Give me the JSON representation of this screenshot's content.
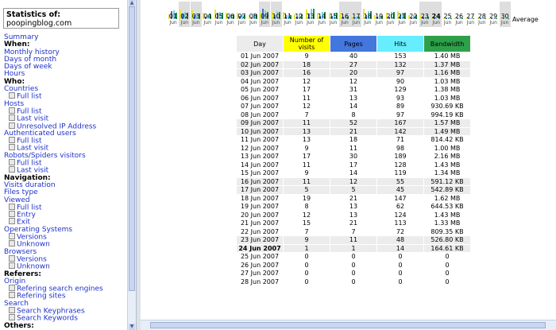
{
  "sidebar": {
    "stat_title": "Statistics of:",
    "stat_site": "poopingblog.com",
    "items": [
      {
        "text": "Summary",
        "kind": "link",
        "indent": 0
      },
      {
        "text": "When:",
        "kind": "hdr",
        "indent": 0
      },
      {
        "text": "Monthly history",
        "kind": "link",
        "indent": 0
      },
      {
        "text": "Days of month",
        "kind": "link",
        "indent": 0
      },
      {
        "text": "Days of week",
        "kind": "link",
        "indent": 0
      },
      {
        "text": "Hours",
        "kind": "link",
        "indent": 0
      },
      {
        "text": "Who:",
        "kind": "hdr",
        "indent": 0
      },
      {
        "text": "Countries",
        "kind": "link",
        "indent": 0
      },
      {
        "text": "Full list",
        "kind": "link",
        "indent": 1
      },
      {
        "text": "Hosts",
        "kind": "link",
        "indent": 0
      },
      {
        "text": "Full list",
        "kind": "link",
        "indent": 1
      },
      {
        "text": "Last visit",
        "kind": "link",
        "indent": 1
      },
      {
        "text": "Unresolved IP Address",
        "kind": "link",
        "indent": 1
      },
      {
        "text": "Authenticated users",
        "kind": "link",
        "indent": 0
      },
      {
        "text": "Full list",
        "kind": "link",
        "indent": 1
      },
      {
        "text": "Last visit",
        "kind": "link",
        "indent": 1
      },
      {
        "text": "Robots/Spiders visitors",
        "kind": "link",
        "indent": 0
      },
      {
        "text": "Full list",
        "kind": "link",
        "indent": 1
      },
      {
        "text": "Last visit",
        "kind": "link",
        "indent": 1
      },
      {
        "text": "Navigation:",
        "kind": "hdr",
        "indent": 0
      },
      {
        "text": "Visits duration",
        "kind": "link",
        "indent": 0
      },
      {
        "text": "Files type",
        "kind": "link",
        "indent": 0
      },
      {
        "text": "Viewed",
        "kind": "link",
        "indent": 0
      },
      {
        "text": "Full list",
        "kind": "link",
        "indent": 1
      },
      {
        "text": "Entry",
        "kind": "link",
        "indent": 1
      },
      {
        "text": "Exit",
        "kind": "link",
        "indent": 1
      },
      {
        "text": "Operating Systems",
        "kind": "link",
        "indent": 0
      },
      {
        "text": "Versions",
        "kind": "link",
        "indent": 1
      },
      {
        "text": "Unknown",
        "kind": "link",
        "indent": 1
      },
      {
        "text": "Browsers",
        "kind": "link",
        "indent": 0
      },
      {
        "text": "Versions",
        "kind": "link",
        "indent": 1
      },
      {
        "text": "Unknown",
        "kind": "link",
        "indent": 1
      },
      {
        "text": "Referers:",
        "kind": "hdr",
        "indent": 0
      },
      {
        "text": "Origin",
        "kind": "link",
        "indent": 0
      },
      {
        "text": "Refering search engines",
        "kind": "link",
        "indent": 1
      },
      {
        "text": "Refering sites",
        "kind": "link",
        "indent": 1
      },
      {
        "text": "Search",
        "kind": "link",
        "indent": 0
      },
      {
        "text": "Search Keyphrases",
        "kind": "link",
        "indent": 1
      },
      {
        "text": "Search Keywords",
        "kind": "link",
        "indent": 1
      },
      {
        "text": "Others:",
        "kind": "hdr",
        "indent": 0
      }
    ]
  },
  "day_strip": {
    "days": [
      "01",
      "02",
      "03",
      "04",
      "05",
      "06",
      "07",
      "08",
      "09",
      "10",
      "11",
      "12",
      "13",
      "14",
      "15",
      "16",
      "17",
      "18",
      "19",
      "20",
      "21",
      "22",
      "23",
      "24",
      "25",
      "26",
      "27",
      "28",
      "29",
      "30"
    ],
    "months": [
      "Jun",
      "Jun",
      "Jun",
      "Jun",
      "Jun",
      "Jun",
      "Jun",
      "Jun",
      "Jun",
      "Jun",
      "Jun",
      "Jun",
      "Jun",
      "Jun",
      "Jun",
      "Jun",
      "Jun",
      "Jun",
      "Jun",
      "Jun",
      "Jun",
      "Jun",
      "Jun",
      "Jun",
      "Jun",
      "Jun",
      "Jun",
      "Jun",
      "Jun",
      "Jun"
    ],
    "weekend": [
      false,
      true,
      true,
      false,
      false,
      false,
      false,
      false,
      true,
      true,
      false,
      false,
      false,
      false,
      false,
      true,
      true,
      false,
      false,
      false,
      false,
      false,
      true,
      true,
      false,
      false,
      false,
      false,
      false,
      true
    ],
    "current": "24",
    "average_label": "Average",
    "colors": {
      "visits": "#eae62e",
      "pages": "#4876c8",
      "hits": "#6fd4e8",
      "bandwidth": "#2a8a4a"
    }
  },
  "table": {
    "headers": {
      "day": "Day",
      "visits": "Number of visits",
      "pages": "Pages",
      "hits": "Hits",
      "bandwidth": "Bandwidth"
    },
    "header_colors": {
      "day": "#ececec",
      "visits": "#ffff00",
      "pages": "#4477dd",
      "hits": "#66eeff",
      "bandwidth": "#2ea04a"
    },
    "rows": [
      {
        "day": "01 Jun 2007",
        "visits": "9",
        "pages": "40",
        "hits": "153",
        "bw": "1.40 MB",
        "alt": false,
        "bold": false
      },
      {
        "day": "02 Jun 2007",
        "visits": "18",
        "pages": "27",
        "hits": "132",
        "bw": "1.37 MB",
        "alt": true,
        "bold": false
      },
      {
        "day": "03 Jun 2007",
        "visits": "16",
        "pages": "20",
        "hits": "97",
        "bw": "1.16 MB",
        "alt": true,
        "bold": false
      },
      {
        "day": "04 Jun 2007",
        "visits": "12",
        "pages": "12",
        "hits": "90",
        "bw": "1.03 MB",
        "alt": false,
        "bold": false
      },
      {
        "day": "05 Jun 2007",
        "visits": "17",
        "pages": "31",
        "hits": "129",
        "bw": "1.38 MB",
        "alt": false,
        "bold": false
      },
      {
        "day": "06 Jun 2007",
        "visits": "11",
        "pages": "13",
        "hits": "93",
        "bw": "1.03 MB",
        "alt": false,
        "bold": false
      },
      {
        "day": "07 Jun 2007",
        "visits": "12",
        "pages": "14",
        "hits": "89",
        "bw": "930.69 KB",
        "alt": false,
        "bold": false
      },
      {
        "day": "08 Jun 2007",
        "visits": "7",
        "pages": "8",
        "hits": "97",
        "bw": "994.19 KB",
        "alt": false,
        "bold": false
      },
      {
        "day": "09 Jun 2007",
        "visits": "11",
        "pages": "52",
        "hits": "167",
        "bw": "1.57 MB",
        "alt": true,
        "bold": false
      },
      {
        "day": "10 Jun 2007",
        "visits": "13",
        "pages": "21",
        "hits": "142",
        "bw": "1.49 MB",
        "alt": true,
        "bold": false
      },
      {
        "day": "11 Jun 2007",
        "visits": "13",
        "pages": "18",
        "hits": "71",
        "bw": "814.42 KB",
        "alt": false,
        "bold": false
      },
      {
        "day": "12 Jun 2007",
        "visits": "9",
        "pages": "11",
        "hits": "98",
        "bw": "1.00 MB",
        "alt": false,
        "bold": false
      },
      {
        "day": "13 Jun 2007",
        "visits": "17",
        "pages": "30",
        "hits": "189",
        "bw": "2.16 MB",
        "alt": false,
        "bold": false
      },
      {
        "day": "14 Jun 2007",
        "visits": "11",
        "pages": "17",
        "hits": "128",
        "bw": "1.43 MB",
        "alt": false,
        "bold": false
      },
      {
        "day": "15 Jun 2007",
        "visits": "9",
        "pages": "14",
        "hits": "119",
        "bw": "1.34 MB",
        "alt": false,
        "bold": false
      },
      {
        "day": "16 Jun 2007",
        "visits": "11",
        "pages": "12",
        "hits": "55",
        "bw": "591.12 KB",
        "alt": true,
        "bold": false
      },
      {
        "day": "17 Jun 2007",
        "visits": "5",
        "pages": "5",
        "hits": "45",
        "bw": "542.89 KB",
        "alt": true,
        "bold": false
      },
      {
        "day": "18 Jun 2007",
        "visits": "19",
        "pages": "21",
        "hits": "147",
        "bw": "1.62 MB",
        "alt": false,
        "bold": false
      },
      {
        "day": "19 Jun 2007",
        "visits": "8",
        "pages": "13",
        "hits": "62",
        "bw": "644.53 KB",
        "alt": false,
        "bold": false
      },
      {
        "day": "20 Jun 2007",
        "visits": "12",
        "pages": "13",
        "hits": "124",
        "bw": "1.43 MB",
        "alt": false,
        "bold": false
      },
      {
        "day": "21 Jun 2007",
        "visits": "15",
        "pages": "21",
        "hits": "113",
        "bw": "1.33 MB",
        "alt": false,
        "bold": false
      },
      {
        "day": "22 Jun 2007",
        "visits": "7",
        "pages": "7",
        "hits": "72",
        "bw": "809.35 KB",
        "alt": false,
        "bold": false
      },
      {
        "day": "23 Jun 2007",
        "visits": "9",
        "pages": "11",
        "hits": "48",
        "bw": "526.80 KB",
        "alt": true,
        "bold": false
      },
      {
        "day": "24 Jun 2007",
        "visits": "1",
        "pages": "1",
        "hits": "14",
        "bw": "164.61 KB",
        "alt": true,
        "bold": true
      },
      {
        "day": "25 Jun 2007",
        "visits": "0",
        "pages": "0",
        "hits": "0",
        "bw": "0",
        "alt": false,
        "bold": false
      },
      {
        "day": "26 Jun 2007",
        "visits": "0",
        "pages": "0",
        "hits": "0",
        "bw": "0",
        "alt": false,
        "bold": false
      },
      {
        "day": "27 Jun 2007",
        "visits": "0",
        "pages": "0",
        "hits": "0",
        "bw": "0",
        "alt": false,
        "bold": false
      },
      {
        "day": "28 Jun 2007",
        "visits": "0",
        "pages": "0",
        "hits": "0",
        "bw": "0",
        "alt": false,
        "bold": false
      }
    ]
  }
}
